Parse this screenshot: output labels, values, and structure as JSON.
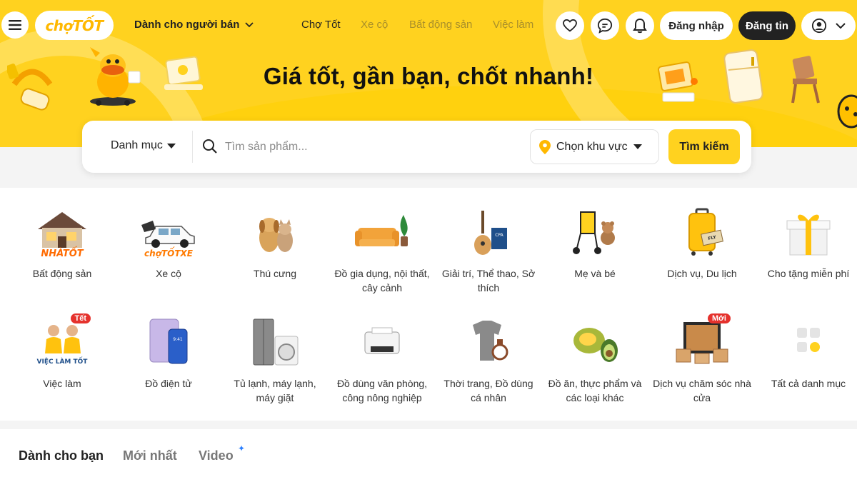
{
  "header": {
    "logo_text": "chợTỐT",
    "seller_menu": "Dành cho người bán",
    "nav": [
      "Chợ Tốt",
      "Xe cộ",
      "Bất động sản",
      "Việc làm"
    ],
    "login": "Đăng nhập",
    "post": "Đăng tin"
  },
  "hero": {
    "title": "Giá tốt, gần bạn, chốt nhanh!"
  },
  "search": {
    "category_label": "Danh mục",
    "placeholder": "Tìm sản phẩm...",
    "region_label": "Chọn khu vực",
    "button": "Tìm kiếm"
  },
  "categories": [
    {
      "label": "Bất động sản"
    },
    {
      "label": "Xe cộ"
    },
    {
      "label": "Thú cưng"
    },
    {
      "label": "Đồ gia dụng, nội thất, cây cảnh"
    },
    {
      "label": "Giải trí, Thể thao, Sở thích"
    },
    {
      "label": "Mẹ và bé"
    },
    {
      "label": "Dịch vụ, Du lịch"
    },
    {
      "label": "Cho tặng miễn phí"
    },
    {
      "label": "Việc làm",
      "badge": "Tết"
    },
    {
      "label": "Đồ điện tử"
    },
    {
      "label": "Tủ lạnh, máy lạnh, máy giặt"
    },
    {
      "label": "Đồ dùng văn phòng, công nông nghiệp"
    },
    {
      "label": "Thời trang, Đồ dùng cá nhân"
    },
    {
      "label": "Đồ ăn, thực phẩm và các loại khác"
    },
    {
      "label": "Dịch vụ chăm sóc nhà cửa",
      "badge": "Mới"
    },
    {
      "label": "Tất cả danh mục"
    }
  ],
  "tabs": [
    "Dành cho bạn",
    "Mới nhất",
    "Video"
  ],
  "category_icon_text": {
    "nha_tot": "NHÀTỐT",
    "cho_tot_xe": "chợTỐTXE",
    "viec_lam_tot": "VIỆC LÀM TỐT"
  },
  "colors": {
    "brand_yellow": "#ffd21f",
    "dark": "#222222",
    "badge_red": "#e5322d"
  }
}
